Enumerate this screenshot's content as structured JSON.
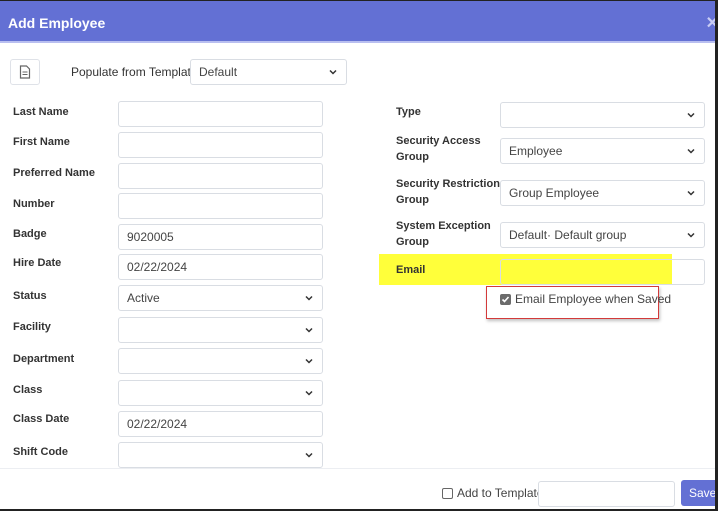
{
  "dialog": {
    "title": "Add Employee",
    "close_icon": "close-icon"
  },
  "template": {
    "icon": "document-icon",
    "label": "Populate from Template",
    "value": "Default"
  },
  "left_fields": [
    {
      "label": "Last Name",
      "type": "text",
      "value": ""
    },
    {
      "label": "First Name",
      "type": "text",
      "value": ""
    },
    {
      "label": "Preferred Name",
      "type": "text",
      "value": ""
    },
    {
      "label": "Number",
      "type": "text",
      "value": ""
    },
    {
      "label": "Badge",
      "type": "text",
      "value": "9020005"
    },
    {
      "label": "Hire Date",
      "type": "text",
      "value": "02/22/2024"
    },
    {
      "label": "Status",
      "type": "select",
      "value": "Active"
    },
    {
      "label": "Facility",
      "type": "select",
      "value": ""
    },
    {
      "label": "Department",
      "type": "select",
      "value": ""
    },
    {
      "label": "Class",
      "type": "select",
      "value": ""
    },
    {
      "label": "Class Date",
      "type": "text",
      "value": "02/22/2024"
    },
    {
      "label": "Shift Code",
      "type": "select",
      "value": ""
    }
  ],
  "right_fields": [
    {
      "label_line1": "Type",
      "label_line2": "",
      "type": "select",
      "value": ""
    },
    {
      "label_line1": "Security Access",
      "label_line2": "Group",
      "type": "select",
      "value": "Employee"
    },
    {
      "label_line1": "Security Restriction",
      "label_line2": "Group",
      "type": "select",
      "value": "Group Employee"
    },
    {
      "label_line1": "System Exception",
      "label_line2": "Group",
      "type": "select",
      "value": "Default· Default group"
    },
    {
      "label_line1": "Email",
      "label_line2": "",
      "type": "text",
      "value": ""
    }
  ],
  "email_employee": {
    "label": "Email Employee when Saved",
    "checked": true
  },
  "footer": {
    "add_to_template_label": "Add to Template",
    "add_to_template_checked": false,
    "template_name_value": "",
    "save_label": "Save"
  },
  "colors": {
    "header": "#6370d4",
    "highlight": "#ffff3a",
    "annotation_box": "#d33a3a"
  }
}
